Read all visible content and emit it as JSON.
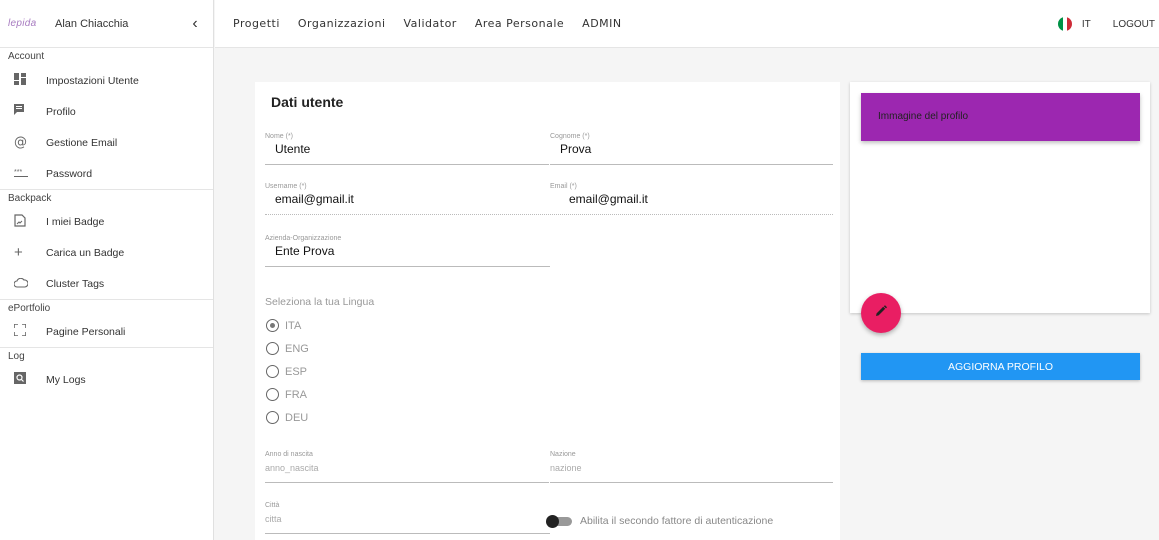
{
  "sidebar": {
    "logo": "lepida",
    "user_name": "Alan Chiacchia",
    "collapse_icon": "‹",
    "sections": [
      {
        "title": "Account",
        "items": [
          {
            "label": "Impostazioni Utente",
            "icon": "dashboard-icon"
          },
          {
            "label": "Profilo",
            "icon": "chat-icon"
          },
          {
            "label": "Gestione Email",
            "icon": "at-icon"
          },
          {
            "label": "Password",
            "icon": "password-icon"
          }
        ]
      },
      {
        "title": "Backpack",
        "items": [
          {
            "label": "I miei Badge",
            "icon": "badge-icon"
          },
          {
            "label": "Carica un Badge",
            "icon": "plus-icon"
          },
          {
            "label": "Cluster Tags",
            "icon": "cloud-icon"
          }
        ]
      },
      {
        "title": "ePortfolio",
        "items": [
          {
            "label": "Pagine Personali",
            "icon": "fullscreen-icon"
          }
        ]
      },
      {
        "title": "Log",
        "items": [
          {
            "label": "My Logs",
            "icon": "log-icon"
          }
        ]
      }
    ]
  },
  "topnav": {
    "links": [
      "Progetti",
      "Organizzazioni",
      "Validator",
      "Area Personale",
      "ADMIN"
    ],
    "language": "IT",
    "logout": "LOGOUT"
  },
  "form": {
    "title": "Dati utente",
    "nome": {
      "label": "Nome (*)",
      "value": "Utente"
    },
    "cognome": {
      "label": "Cognome (*)",
      "value": "Prova"
    },
    "username": {
      "label": "Username (*)",
      "value": "email@gmail.it"
    },
    "email": {
      "label": "Email (*)",
      "value": "email@gmail.it"
    },
    "azienda": {
      "label": "Azienda-Organizzazione",
      "value": "Ente Prova"
    },
    "lang_title": "Seleziona la tua Lingua",
    "languages": [
      {
        "label": "ITA",
        "selected": true
      },
      {
        "label": "ENG",
        "selected": false
      },
      {
        "label": "ESP",
        "selected": false
      },
      {
        "label": "FRA",
        "selected": false
      },
      {
        "label": "DEU",
        "selected": false
      }
    ],
    "anno": {
      "label": "Anno di nascita",
      "placeholder": "anno_nascita"
    },
    "nazione": {
      "label": "Nazione",
      "placeholder": "nazione"
    },
    "citta": {
      "label": "Città",
      "placeholder": "citta"
    },
    "two_factor": "Abilita il secondo fattore di autenticazione"
  },
  "profile_image": {
    "title": "Immagine del profilo",
    "update_button": "AGGIORNA PROFILO"
  }
}
